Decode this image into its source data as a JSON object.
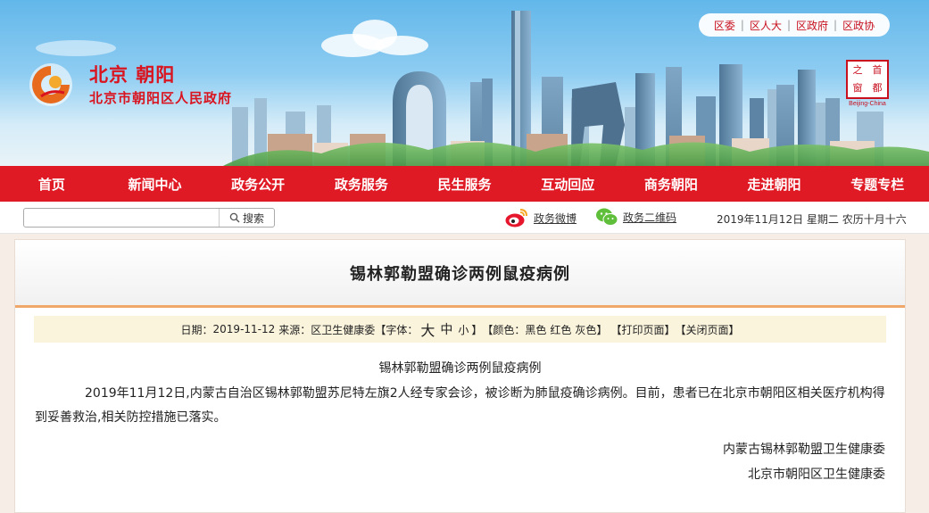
{
  "header": {
    "top_links": [
      "区委",
      "区人大",
      "区政府",
      "区政协"
    ],
    "logo_line1": "北京 朝阳",
    "logo_line2": "北京市朝阳区人民政府",
    "seal_chars": [
      "之",
      "首",
      "窗",
      "都"
    ],
    "seal_caption": "Beijing-China"
  },
  "nav": {
    "items": [
      "首页",
      "新闻中心",
      "政务公开",
      "政务服务",
      "民生服务",
      "互动回应",
      "商务朝阳",
      "走进朝阳",
      "专题专栏"
    ]
  },
  "toolbar": {
    "search_value": "",
    "search_button": "搜索",
    "weibo_label": "政务微博",
    "wechat_label": "政务二维码",
    "date": "2019年11月12日 星期二 农历十月十六"
  },
  "article": {
    "title": "锡林郭勒盟确诊两例鼠疫病例",
    "meta": {
      "date_label": "日期：",
      "date_value": "2019-11-12",
      "source_label": "来源：",
      "source_value": "区卫生健康委",
      "font_open": "【字体：",
      "font_large": "大",
      "font_medium": "中",
      "font_small": "小",
      "font_close": "】",
      "color_open": "【颜色：",
      "color_black": "黑色",
      "color_red": "红色",
      "color_gray": "灰色",
      "color_close": "】",
      "print": "【打印页面】",
      "close": "【关闭页面】"
    },
    "sub_title": "锡林郭勒盟确诊两例鼠疫病例",
    "paragraph": "2019年11月12日,内蒙古自治区锡林郭勒盟苏尼特左旗2人经专家会诊，被诊断为肺鼠疫确诊病例。目前，患者已在北京市朝阳区相关医疗机构得到妥善救治,相关防控措施已落实。",
    "signature_1": "内蒙古锡林郭勒盟卫生健康委",
    "signature_2": "北京市朝阳区卫生健康委"
  },
  "colors": {
    "brand_red": "#e01a25",
    "title_underline": "#f0a86a",
    "meta_bg": "#fbf4dd"
  }
}
